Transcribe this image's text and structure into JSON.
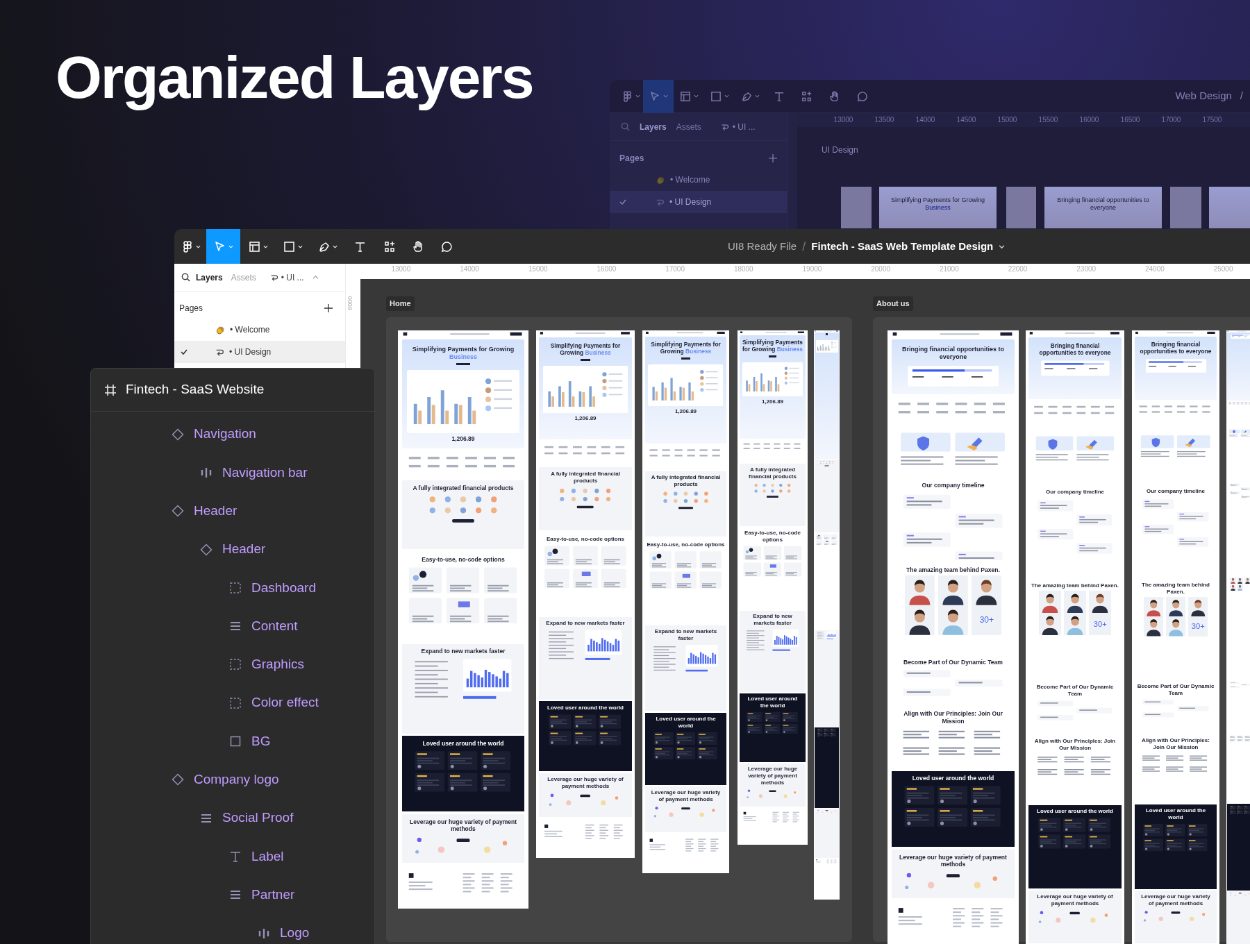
{
  "headline": "Organized Layers",
  "background_window": {
    "tools": [
      {
        "kind": "main-menu",
        "selected": false
      },
      {
        "kind": "move",
        "selected": true
      },
      {
        "kind": "frame",
        "selected": false
      },
      {
        "kind": "shape",
        "selected": false
      },
      {
        "kind": "pen",
        "selected": false
      },
      {
        "kind": "text",
        "selected": false
      },
      {
        "kind": "components",
        "selected": false
      },
      {
        "kind": "hand",
        "selected": false
      },
      {
        "kind": "comment",
        "selected": false
      }
    ],
    "breadcrumb": "Web Design",
    "breadcrumb_separator": "/",
    "tabs": [
      {
        "label": "Layers",
        "selected": true
      },
      {
        "label": "Assets",
        "selected": false
      }
    ],
    "page_switcher": "• UI ...",
    "pages_label": "Pages",
    "pages": [
      {
        "label": "• Welcome",
        "kind": "wave",
        "selected": false
      },
      {
        "label": "• UI Design",
        "kind": "link",
        "selected": true
      }
    ],
    "ruler": [
      "13000",
      "13500",
      "14000",
      "14500",
      "15000",
      "15500",
      "16000",
      "16500",
      "17000",
      "17500"
    ],
    "canvas_label": "UI Design",
    "thumbnails": [
      {
        "kind": "narrow"
      },
      {
        "kind": "wide",
        "heading": "Simplifying Payments for Growing",
        "accent": "Business"
      },
      {
        "kind": "narrow"
      },
      {
        "kind": "wide",
        "heading": "Bringing financial opportunities to everyone"
      },
      {
        "kind": "narrow"
      },
      {
        "kind": "wide"
      }
    ]
  },
  "window": {
    "tools": [
      {
        "kind": "main-menu",
        "selected": false
      },
      {
        "kind": "move",
        "selected": true
      },
      {
        "kind": "frame",
        "selected": false
      },
      {
        "kind": "shape",
        "selected": false
      },
      {
        "kind": "pen",
        "selected": false
      },
      {
        "kind": "text",
        "selected": false
      },
      {
        "kind": "components",
        "selected": false
      },
      {
        "kind": "hand",
        "selected": false
      },
      {
        "kind": "comment",
        "selected": false
      }
    ],
    "project": "UI8 Ready File",
    "separator": "/",
    "file_name": "Fintech - SaaS Web Template Design",
    "tabs": [
      {
        "label": "Layers",
        "selected": true
      },
      {
        "label": "Assets",
        "selected": false
      }
    ],
    "page_switcher": "• UI ...",
    "pages_label": "Pages",
    "pages": [
      {
        "label": "• Welcome",
        "kind": "wave",
        "selected": false
      },
      {
        "label": "• UI Design",
        "kind": "link",
        "selected": true
      }
    ],
    "ruler": [
      "13000",
      "14000",
      "15000",
      "16000",
      "17000",
      "18000",
      "19000",
      "20000",
      "21000",
      "22000",
      "23000",
      "24000",
      "25000"
    ],
    "vertical_ruler": [
      "6000"
    ],
    "sections": [
      {
        "label": "Home",
        "frames": [
          {
            "sections": [
              {
                "kind": "hero",
                "heading": "Simplifying Payments for Growing",
                "accent": "Business",
                "amount": "1,206.89"
              },
              {
                "kind": "logos"
              },
              {
                "kind": "features",
                "heading": "A fully integrated financial products"
              },
              {
                "kind": "options",
                "heading": "Easy-to-use, no-code options"
              },
              {
                "kind": "expand",
                "heading": "Expand to new markets faster"
              },
              {
                "kind": "dark",
                "heading": "Loved user around the world"
              },
              {
                "kind": "payment",
                "heading": "Leverage our huge variety of payment methods"
              },
              {
                "kind": "footer"
              }
            ]
          },
          {
            "sections": [
              {
                "kind": "hero",
                "heading": "Simplifying Payments for Growing",
                "accent": "Business",
                "amount": "1,206.89"
              },
              {
                "kind": "logos"
              },
              {
                "kind": "features",
                "heading": "A fully integrated financial products"
              },
              {
                "kind": "options",
                "heading": "Easy-to-use, no-code options"
              },
              {
                "kind": "expand",
                "heading": "Expand to new markets faster"
              },
              {
                "kind": "dark",
                "heading": "Loved user around the world"
              },
              {
                "kind": "payment",
                "heading": "Leverage our huge variety of payment methods"
              },
              {
                "kind": "footer"
              }
            ]
          },
          {
            "sections": [
              {
                "kind": "hero",
                "heading": "Simplifying Payments for Growing",
                "accent": "Business",
                "amount": "1,206.89"
              },
              {
                "kind": "logos"
              },
              {
                "kind": "features",
                "heading": "A fully integrated financial products"
              },
              {
                "kind": "options",
                "heading": "Easy-to-use, no-code options"
              },
              {
                "kind": "expand",
                "heading": "Expand to new markets faster"
              },
              {
                "kind": "dark",
                "heading": "Loved user around the world"
              },
              {
                "kind": "payment",
                "heading": "Leverage our huge variety of payment methods"
              },
              {
                "kind": "footer"
              }
            ]
          },
          {
            "sections": [
              {
                "kind": "hero",
                "heading": "Simplifying Payments for Growing",
                "accent": "Business",
                "amount": "1,206.89"
              },
              {
                "kind": "logos"
              },
              {
                "kind": "features",
                "heading": "A fully integrated financial products"
              },
              {
                "kind": "options",
                "heading": "Easy-to-use, no-code options"
              },
              {
                "kind": "expand",
                "heading": "Expand to new markets faster"
              },
              {
                "kind": "dark",
                "heading": "Loved user around the world"
              },
              {
                "kind": "payment",
                "heading": "Leverage our huge variety of payment methods"
              },
              {
                "kind": "footer"
              }
            ]
          },
          {
            "sections": [
              {
                "kind": "hero"
              },
              {
                "kind": "features"
              },
              {
                "kind": "options"
              },
              {
                "kind": "expand"
              },
              {
                "kind": "dark"
              },
              {
                "kind": "payment"
              },
              {
                "kind": "footer"
              }
            ]
          }
        ]
      },
      {
        "label": "About us",
        "frames": [
          {
            "sections": [
              {
                "kind": "intro",
                "heading": "Bringing financial opportunities to everyone"
              },
              {
                "kind": "logos"
              },
              {
                "kind": "cards"
              },
              {
                "kind": "timeline",
                "heading": "Our company timeline"
              },
              {
                "kind": "team",
                "heading": "The amazing team behind Paxen.",
                "count": "30+"
              },
              {
                "kind": "join",
                "heading": "Become Part of Our Dynamic Team"
              },
              {
                "kind": "principles",
                "heading": "Align with Our Principles: Join Our Mission"
              },
              {
                "kind": "dark",
                "heading": "Loved user around the world"
              },
              {
                "kind": "payment",
                "heading": "Leverage our huge variety of payment methods"
              },
              {
                "kind": "footer"
              }
            ]
          },
          {
            "sections": [
              {
                "kind": "intro",
                "heading": "Bringing financial opportunities to everyone"
              },
              {
                "kind": "logos"
              },
              {
                "kind": "cards"
              },
              {
                "kind": "timeline",
                "heading": "Our company timeline"
              },
              {
                "kind": "team",
                "heading": "The amazing team behind Paxen.",
                "count": "30+"
              },
              {
                "kind": "join",
                "heading": "Become Part of Our Dynamic Team"
              },
              {
                "kind": "principles",
                "heading": "Align with Our Principles: Join Our Mission"
              },
              {
                "kind": "dark",
                "heading": "Loved user around the world"
              },
              {
                "kind": "payment",
                "heading": "Leverage our huge variety of payment methods"
              }
            ]
          },
          {
            "sections": [
              {
                "kind": "intro",
                "heading": "Bringing financial opportunities to everyone"
              },
              {
                "kind": "logos"
              },
              {
                "kind": "cards"
              },
              {
                "kind": "timeline",
                "heading": "Our company timeline"
              },
              {
                "kind": "team",
                "heading": "The amazing team behind Paxen.",
                "count": "30+"
              },
              {
                "kind": "join",
                "heading": "Become Part of Our Dynamic Team"
              },
              {
                "kind": "principles",
                "heading": "Align with Our Principles: Join Our Mission"
              },
              {
                "kind": "dark",
                "heading": "Loved user around the world"
              },
              {
                "kind": "payment",
                "heading": "Leverage our huge variety of payment methods"
              }
            ]
          },
          {
            "sections": [
              {
                "kind": "intro"
              },
              {
                "kind": "logos"
              },
              {
                "kind": "cards"
              },
              {
                "kind": "timeline"
              },
              {
                "kind": "team"
              },
              {
                "kind": "join"
              },
              {
                "kind": "principles"
              },
              {
                "kind": "dark"
              },
              {
                "kind": "payment"
              }
            ]
          }
        ]
      }
    ]
  },
  "layers_panel": {
    "title": "Fintech - SaaS Website",
    "items": [
      {
        "label": "Navigation",
        "kind": "component",
        "children": [
          {
            "label": "Navigation bar",
            "kind": "columns"
          }
        ]
      },
      {
        "label": "Header",
        "kind": "component",
        "children": [
          {
            "label": "Header",
            "kind": "component",
            "children": [
              {
                "label": "Dashboard",
                "kind": "frame"
              },
              {
                "label": "Content",
                "kind": "stack"
              },
              {
                "label": "Graphics",
                "kind": "frame"
              },
              {
                "label": "Color effect",
                "kind": "frame"
              },
              {
                "label": "BG",
                "kind": "rect"
              }
            ]
          }
        ]
      },
      {
        "label": "Company logo",
        "kind": "component",
        "children": [
          {
            "label": "Social Proof",
            "kind": "stack",
            "children": [
              {
                "label": "Label",
                "kind": "text"
              },
              {
                "label": "Partner",
                "kind": "stack",
                "children": [
                  {
                    "label": "Logo",
                    "kind": "columns"
                  }
                ]
              }
            ]
          }
        ]
      }
    ]
  }
}
